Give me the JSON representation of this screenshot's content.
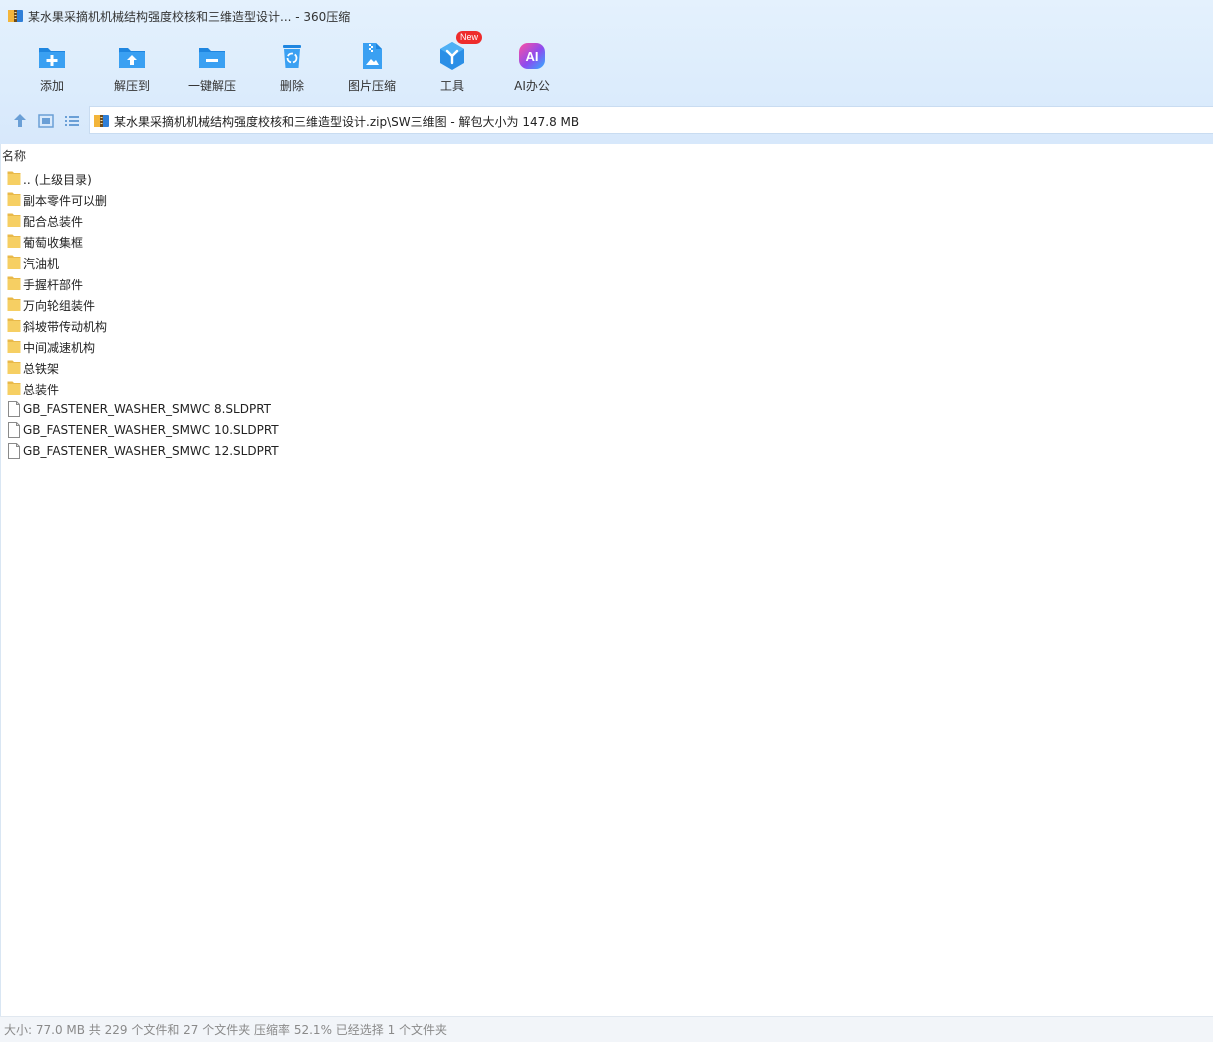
{
  "window": {
    "title": "某水果采摘机机械结构强度校核和三维造型设计... - 360压缩"
  },
  "toolbar": {
    "items": [
      {
        "label": "添加",
        "icon": "add-icon"
      },
      {
        "label": "解压到",
        "icon": "extract-to-icon"
      },
      {
        "label": "一键解压",
        "icon": "one-click-extract-icon"
      },
      {
        "label": "删除",
        "icon": "delete-icon"
      },
      {
        "label": "图片压缩",
        "icon": "image-compress-icon"
      },
      {
        "label": "工具",
        "icon": "tools-icon",
        "badge": "New"
      },
      {
        "label": "AI办公",
        "icon": "ai-office-icon",
        "glyph": "AI"
      }
    ]
  },
  "nav": {
    "up_icon": "up-arrow-icon",
    "view_icon": "thumbnail-view-icon",
    "list_icon": "list-view-icon"
  },
  "address": {
    "path": "某水果采摘机机械结构强度校核和三维造型设计.zip\\SW三维图 - 解包大小为 147.8 MB"
  },
  "list": {
    "header_name": "名称",
    "rows": [
      {
        "name": ".. (上级目录)",
        "type": "folder"
      },
      {
        "name": "副本零件可以删",
        "type": "folder"
      },
      {
        "name": "配合总装件",
        "type": "folder"
      },
      {
        "name": "葡萄收集框",
        "type": "folder"
      },
      {
        "name": "汽油机",
        "type": "folder"
      },
      {
        "name": "手握杆部件",
        "type": "folder"
      },
      {
        "name": "万向轮组装件",
        "type": "folder"
      },
      {
        "name": "斜坡带传动机构",
        "type": "folder"
      },
      {
        "name": "中间减速机构",
        "type": "folder"
      },
      {
        "name": "总铁架",
        "type": "folder"
      },
      {
        "name": "总装件",
        "type": "folder"
      },
      {
        "name": "GB_FASTENER_WASHER_SMWC 8.SLDPRT",
        "type": "file"
      },
      {
        "name": "GB_FASTENER_WASHER_SMWC 10.SLDPRT",
        "type": "file"
      },
      {
        "name": "GB_FASTENER_WASHER_SMWC 12.SLDPRT",
        "type": "file"
      }
    ]
  },
  "status": {
    "text": "大小: 77.0 MB 共 229 个文件和 27 个文件夹 压缩率 52.1% 已经选择 1 个文件夹"
  },
  "colors": {
    "accent_blue": "#2b8fe6",
    "folder_yellow": "#f6cf63",
    "badge_red": "#ee2c2c"
  }
}
